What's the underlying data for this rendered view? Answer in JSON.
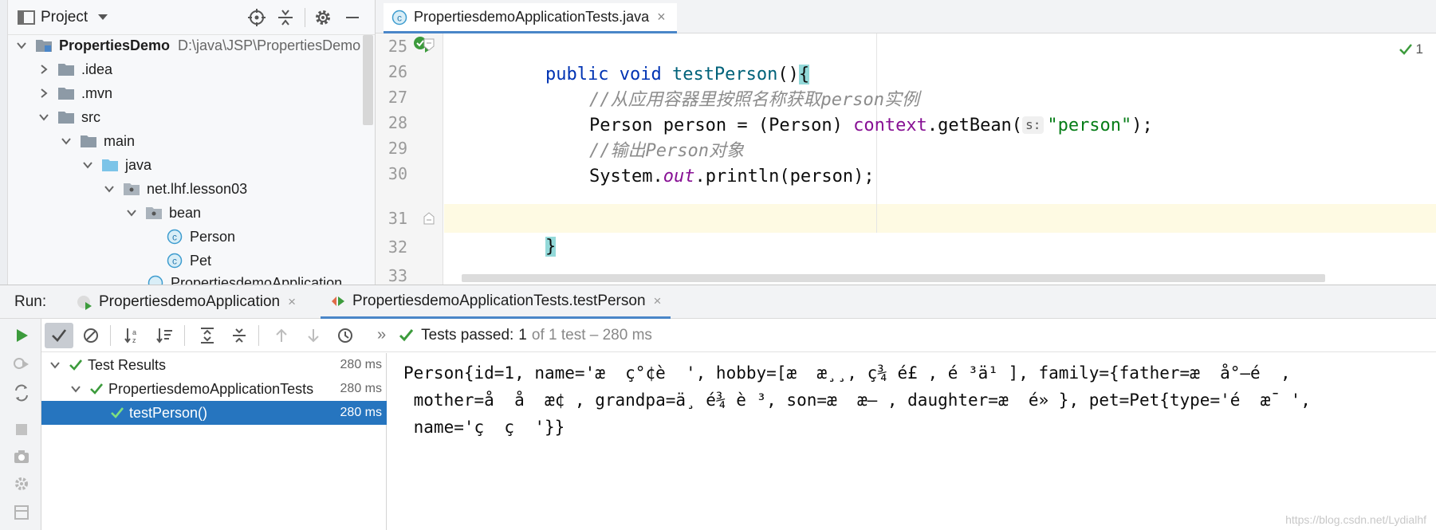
{
  "project": {
    "title": "Project",
    "root_name": "PropertiesDemo",
    "root_path": "D:\\java\\JSP\\PropertiesDemo",
    "items": [
      {
        "label": ".idea"
      },
      {
        "label": ".mvn"
      },
      {
        "label": "src"
      },
      {
        "label": "main"
      },
      {
        "label": "java"
      },
      {
        "label": "net.lhf.lesson03"
      },
      {
        "label": "bean"
      },
      {
        "label": "Person"
      },
      {
        "label": "Pet"
      },
      {
        "label": "PropertiesdemoApplication"
      }
    ]
  },
  "editor": {
    "tab_label": "PropertiesdemoApplicationTests.java",
    "tab_close": "×",
    "line_numbers": [
      "25",
      "26",
      "27",
      "28",
      "29",
      "30",
      "31",
      "32",
      "33"
    ],
    "inspection_count": "1",
    "code": {
      "l25_kw1": "public",
      "l25_kw2": "void",
      "l25_fn": "testPerson",
      "l25_paren": "()",
      "l25_brace": "{",
      "l26_comment": "//从应用容器里按照名称获取person实例",
      "l27_a": "Person person = (Person) ",
      "l27_context": "context",
      "l27_b": ".getBean(",
      "l27_hint": "s:",
      "l27_str": "\"person\"",
      "l27_c": ");",
      "l28_comment": "//输出Person对象",
      "l29_a": "System.",
      "l29_out": "out",
      "l29_b": ".println(person);",
      "l31_brace": "}",
      "l33_brace": "}"
    }
  },
  "run": {
    "label": "Run:",
    "tabs": [
      {
        "label": "PropertiesdemoApplication",
        "close": "×"
      },
      {
        "label": "PropertiesdemoApplicationTests.testPerson",
        "close": "×"
      }
    ],
    "status": {
      "prefix": "Tests passed:",
      "count": "1",
      "suffix": "of 1 test – 280 ms",
      "chevron": "»"
    },
    "tree": [
      {
        "name": "Test Results",
        "time": "280 ms"
      },
      {
        "name": "PropertiesdemoApplicationTests",
        "time": "280 ms"
      },
      {
        "name": "testPerson()",
        "time": "280 ms"
      }
    ],
    "output": [
      "Person{id=1, name='æ  ç°¢è  ', hobby=[æ  æ¸¸, ç¾ é£ , é ³ä¹ ], family={father=æ  å°–é  ,",
      " mother=å  å  æ¢ , grandpa=ä¸ é¾ è ³, son=æ  æ– , daughter=æ  é» }, pet=Pet{type='é  æ¯ ',",
      " name='ç  ç  '}}"
    ],
    "watermark": "https://blog.csdn.net/Lydialhf"
  },
  "colors": {
    "accent": "#4a86c8",
    "selection": "#2675bf",
    "success": "#3c9b3c",
    "keyword": "#0033b3",
    "string": "#067d17",
    "field": "#871094",
    "comment": "#8c8c8c"
  }
}
